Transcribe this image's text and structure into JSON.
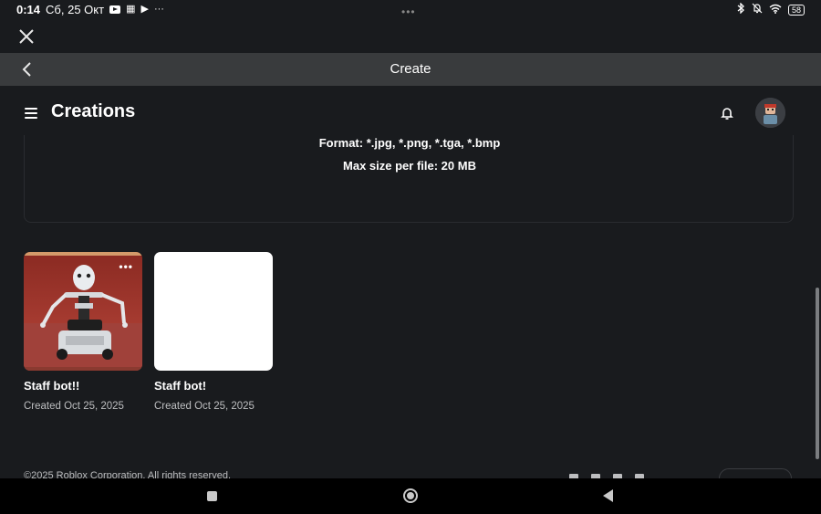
{
  "status_bar": {
    "time": "0:14",
    "date": "Сб, 25 Окт",
    "center_dots": "•••",
    "battery": "58"
  },
  "title_bar": {
    "title": "Create"
  },
  "header": {
    "title": "Creations"
  },
  "upload": {
    "format": "Format: *.jpg, *.png, *.tga, *.bmp",
    "max_size": "Max size per file: 20 MB"
  },
  "creations": [
    {
      "name": "Staff bot!!",
      "created": "Created Oct 25, 2025",
      "more": "•••"
    },
    {
      "name": "Staff bot!",
      "created": "Created Oct 25, 2025"
    }
  ],
  "footer": {
    "copyright": "©2025 Roblox Corporation. All rights reserved."
  }
}
